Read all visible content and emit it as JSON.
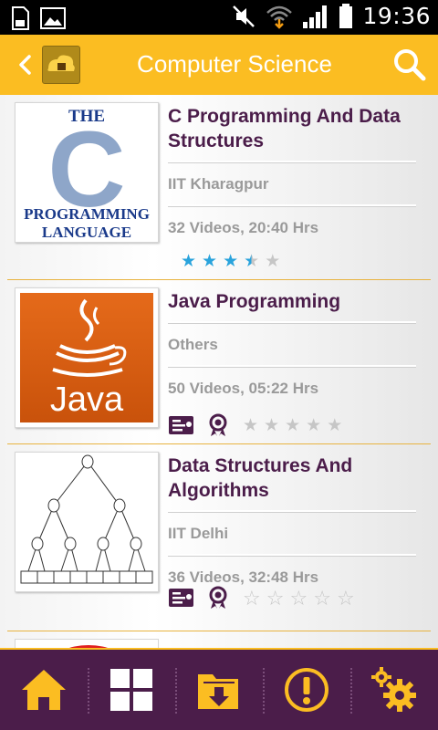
{
  "status_bar": {
    "time": "19:36"
  },
  "header": {
    "title": "Computer Science"
  },
  "courses": [
    {
      "title": "C Programming And Data Structures",
      "institute": "IIT Kharagpur",
      "stats": "32 Videos, 20:40 Hrs",
      "rating": 3.5,
      "thumb_lines": [
        "THE",
        "C",
        "PROGRAMMING",
        "LANGUAGE"
      ]
    },
    {
      "title": "Java Programming",
      "institute": "Others",
      "stats": "50 Videos, 05:22 Hrs",
      "rating": 0,
      "thumb_lines": [
        "Java"
      ]
    },
    {
      "title": "Data Structures And Algorithms",
      "institute": "IIT Delhi",
      "stats": "36 Videos, 32:48 Hrs",
      "rating": 0
    }
  ],
  "colors": {
    "accent": "#fbbd22",
    "brand": "#4b1d4a",
    "star_filled": "#29a3dc",
    "star_empty": "#c6c6c6"
  },
  "bottom_nav": [
    {
      "icon": "home-icon"
    },
    {
      "icon": "grid-icon"
    },
    {
      "icon": "download-folder-icon"
    },
    {
      "icon": "alert-icon"
    },
    {
      "icon": "settings-icon"
    }
  ]
}
